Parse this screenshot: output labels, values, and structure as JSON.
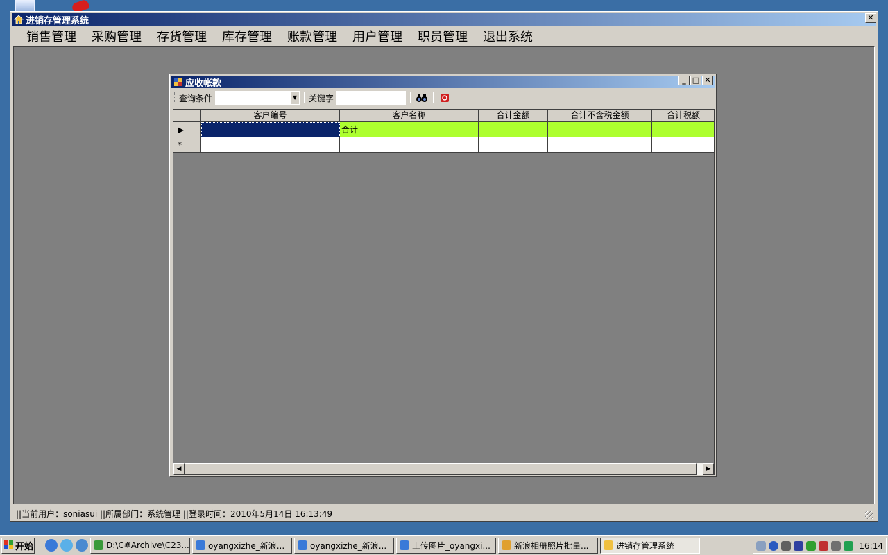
{
  "app": {
    "title": "进销存管理系统",
    "menu": [
      "销售管理",
      "采购管理",
      "存货管理",
      "库存管理",
      "账款管理",
      "用户管理",
      "职员管理",
      "退出系统"
    ],
    "status": "||当前用户：soniasui ||所属部门：系统管理 ||登录时间：2010年5月14日 16:13:49"
  },
  "child": {
    "title": "应收帐款",
    "toolbar": {
      "query_label": "查询条件",
      "query_value": "",
      "keyword_label": "关键字",
      "keyword_value": ""
    },
    "grid": {
      "columns": [
        "客户编号",
        "客户名称",
        "合计金额",
        "合计不含税金额",
        "合计税额"
      ],
      "rows": [
        [
          "",
          "合计",
          "",
          "",
          ""
        ]
      ],
      "new_row_marker": "*",
      "current_row_marker": "▶"
    }
  },
  "taskbar": {
    "start_label": "开始",
    "tasks": [
      "D:\\C#Archive\\C23...",
      "oyangxizhe_新浪...",
      "oyangxizhe_新浪...",
      "上传图片_oyangxi...",
      "新浪相册照片批量...",
      "进销存管理系统"
    ],
    "clock": "16:14"
  },
  "colors": {
    "title_gradient_start": "#0a246a",
    "title_gradient_end": "#a6caf0",
    "grid_row_highlight": "#adff2f",
    "desktop": "#3a6ea5"
  }
}
